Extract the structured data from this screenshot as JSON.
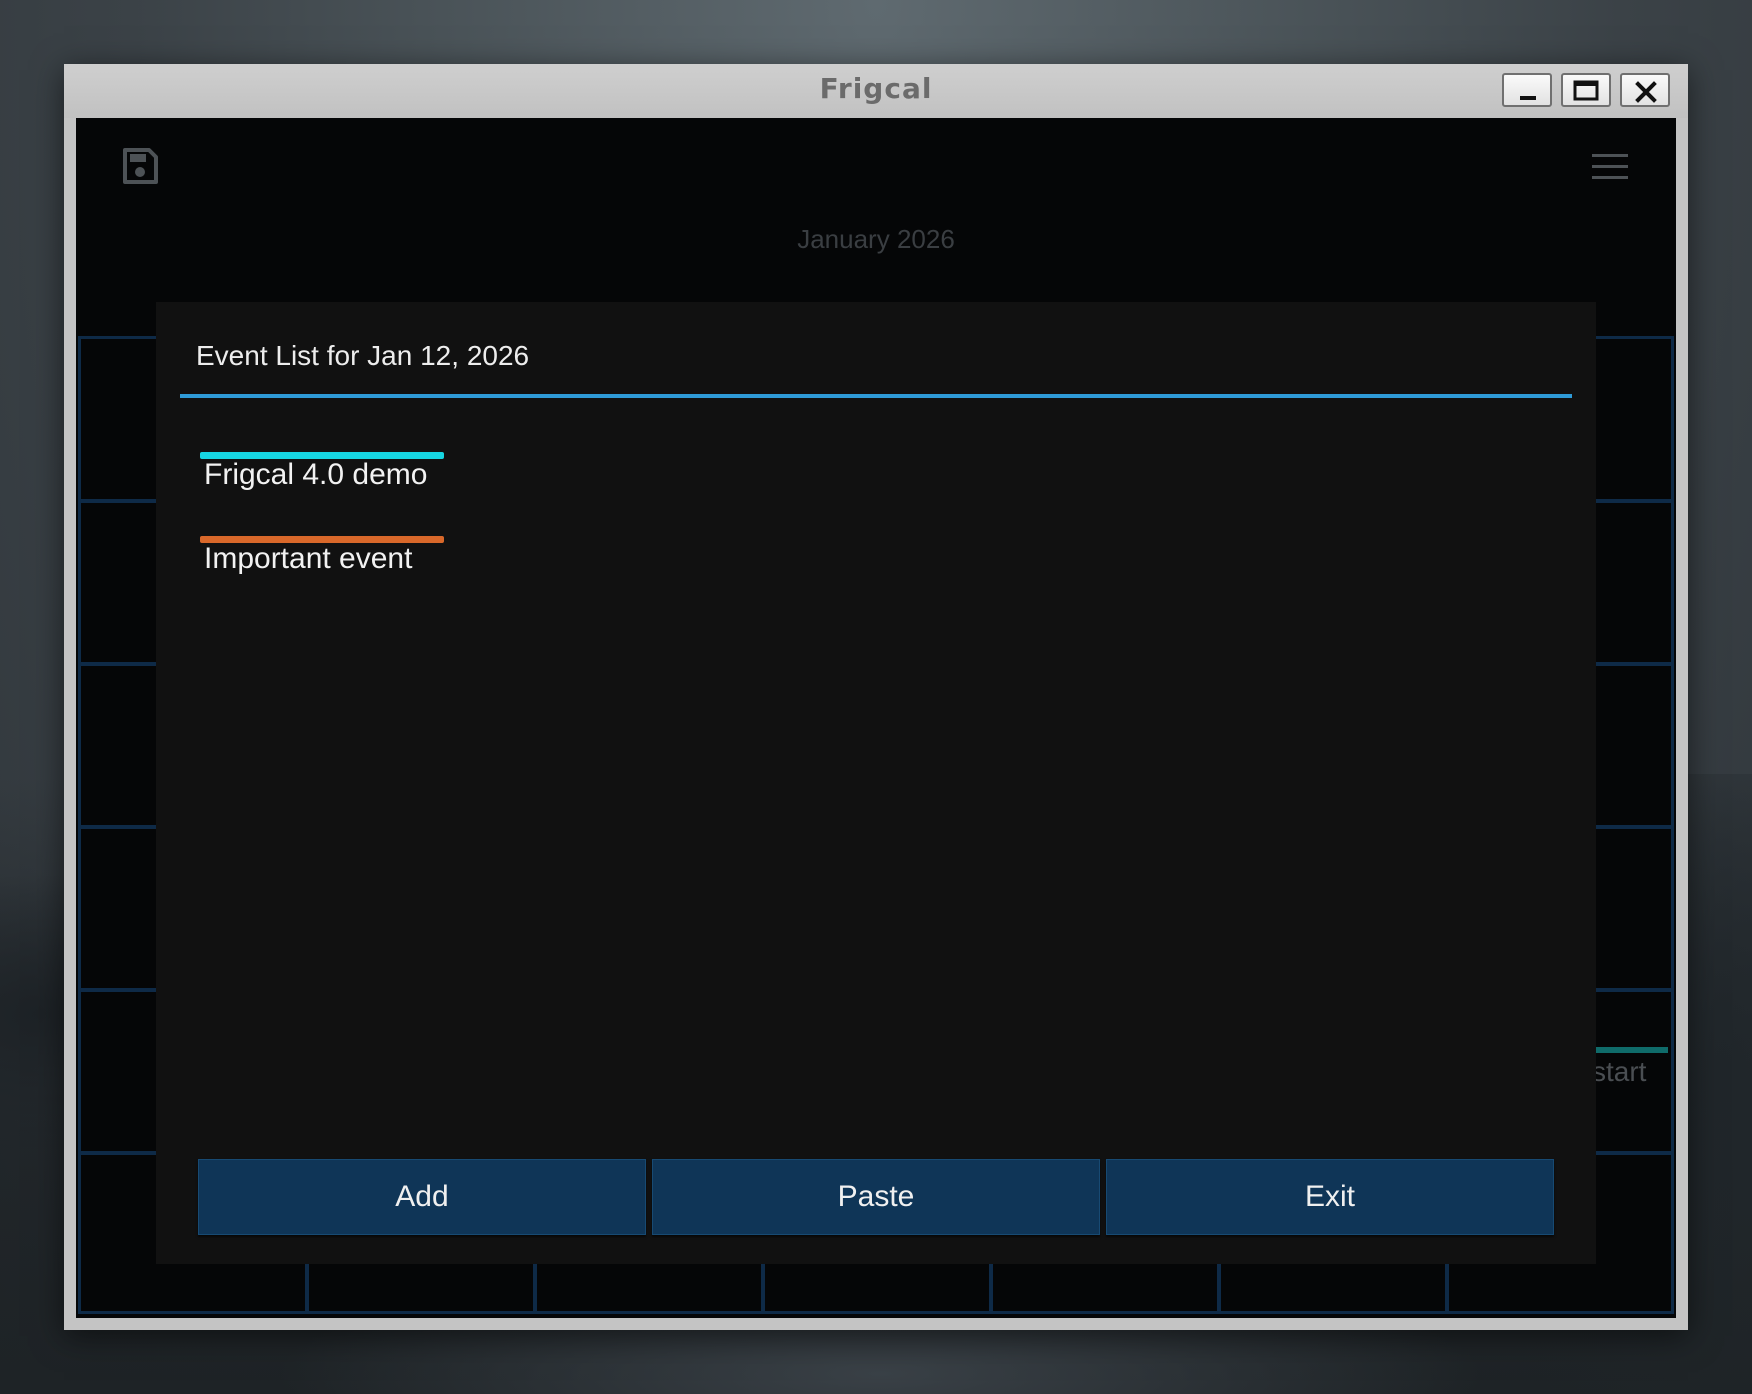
{
  "window": {
    "title": "Frigcal"
  },
  "toolbar": {
    "save_icon": "save-icon",
    "menu_icon": "hamburger-menu-icon"
  },
  "calendar": {
    "month_label": "January 2026",
    "partial_event_text": "start",
    "partial_event_color": "#0f6b6a"
  },
  "dialog": {
    "title": "Event List for Jan 12, 2026",
    "events": [
      {
        "label": "Frigcal 4.0 demo",
        "color": "#16d6e2"
      },
      {
        "label": "Important event",
        "color": "#d9682a"
      }
    ],
    "buttons": {
      "add": "Add",
      "paste": "Paste",
      "exit": "Exit"
    }
  },
  "colors": {
    "accent_separator": "#2f9bd8",
    "button_bg": "#0f3557",
    "grid_line": "#0e2a47"
  }
}
